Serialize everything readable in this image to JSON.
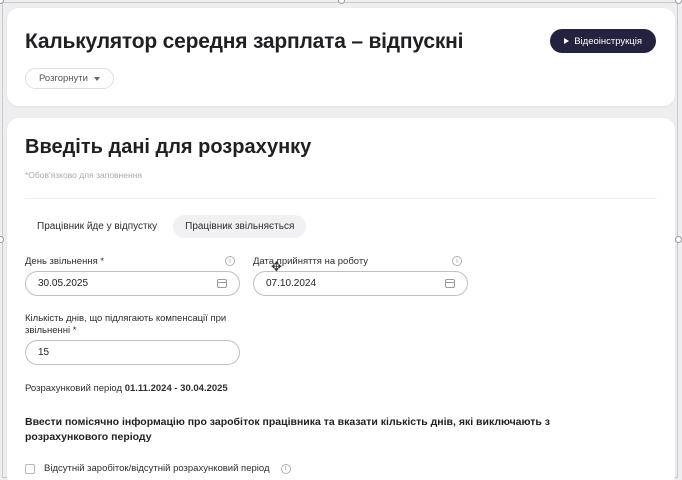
{
  "header": {
    "title": "Калькулятор середня зарплата – відпускні",
    "video_button": "Відеоінструкція",
    "expand_button": "Розгорнути"
  },
  "form": {
    "section_title": "Введіть дані для розрахунку",
    "required_note": "*Обов'язково для заповнення",
    "tabs": [
      {
        "label": "Працівник йде у відпустку",
        "active": false
      },
      {
        "label": "Працівник звільняється",
        "active": true
      }
    ],
    "dismissal_date": {
      "label": "День звільнення *",
      "value": "30.05.2025"
    },
    "hire_date": {
      "label": "Дата прийняття на роботу",
      "value": "07.10.2024"
    },
    "compensation_days": {
      "label": "Кількість днів, що підлягають компенсації при звільненні *",
      "value": "15"
    },
    "period_label": "Розрахунковий період",
    "period_value": "01.11.2024 - 30.04.2025",
    "monthly_note": "Ввести помісячно інформацію про заробіток працівника та вказати кількість днів, які виключають з розрахункового періоду",
    "missing_earnings_checkbox": "Відсутній заробіток/відсутній розрахунковий період"
  },
  "colors": {
    "primary_button": "#23233f",
    "background": "#eeeef0",
    "card": "#ffffff"
  }
}
